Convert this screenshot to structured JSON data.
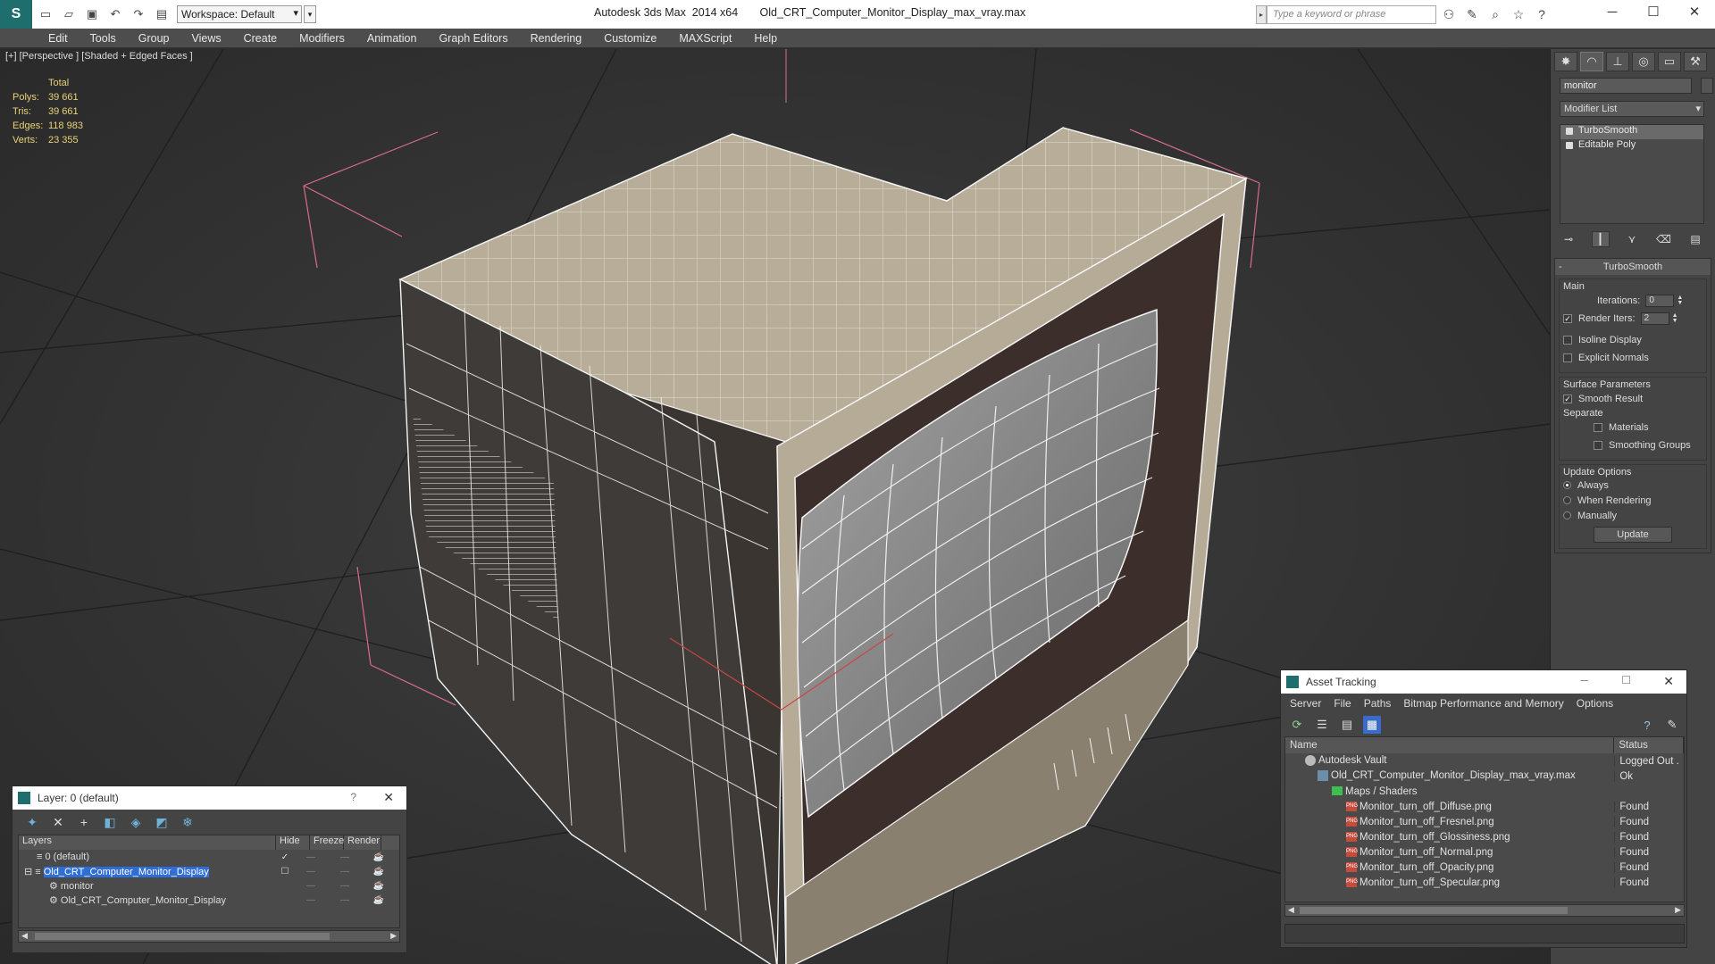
{
  "titlebar": {
    "workspace": "Workspace: Default",
    "title": "Autodesk 3ds Max  2014 x64       Old_CRT_Computer_Monitor_Display_max_vray.max",
    "search_placeholder": "Type a keyword or phrase"
  },
  "menu": [
    "Edit",
    "Tools",
    "Group",
    "Views",
    "Create",
    "Modifiers",
    "Animation",
    "Graph Editors",
    "Rendering",
    "Customize",
    "MAXScript",
    "Help"
  ],
  "viewport": {
    "label": "[+] [Perspective ] [Shaded + Edged Faces ]",
    "stats": {
      "header": "Total",
      "rows": [
        {
          "k": "Polys:",
          "v": "39 661"
        },
        {
          "k": "Tris:",
          "v": "39 661"
        },
        {
          "k": "Edges:",
          "v": "118 983"
        },
        {
          "k": "Verts:",
          "v": "23 355"
        }
      ]
    }
  },
  "command_panel": {
    "object_name": "monitor",
    "modifier_list": "Modifier List",
    "stack": [
      "TurboSmooth",
      "Editable Poly"
    ],
    "rollout_title": "TurboSmooth",
    "main_group": "Main",
    "iterations_label": "Iterations:",
    "iterations_value": "0",
    "render_iters_label": "Render Iters:",
    "render_iters_value": "2",
    "isoline": "Isoline Display",
    "explicit_normals": "Explicit Normals",
    "surface_group": "Surface Parameters",
    "smooth_result": "Smooth Result",
    "separate": "Separate",
    "materials": "Materials",
    "smoothing_groups": "Smoothing Groups",
    "update_group": "Update Options",
    "always": "Always",
    "when_rendering": "When Rendering",
    "manually": "Manually",
    "update_btn": "Update"
  },
  "layers": {
    "title": "Layer: 0 (default)",
    "help": "?",
    "columns": {
      "name": "Layers",
      "hide": "Hide",
      "freeze": "Freeze",
      "render": "Render"
    },
    "rows": [
      {
        "name": "0 (default)"
      },
      {
        "name": "Old_CRT_Computer_Monitor_Display"
      },
      {
        "name": "monitor"
      },
      {
        "name": "Old_CRT_Computer_Monitor_Display"
      }
    ]
  },
  "asset": {
    "title": "Asset Tracking",
    "menu": [
      "Server",
      "File",
      "Paths",
      "Bitmap Performance and Memory",
      "Options"
    ],
    "columns": {
      "name": "Name",
      "status": "Status"
    },
    "rows": [
      {
        "name": "Autodesk Vault",
        "status": "Logged Out ."
      },
      {
        "name": "Old_CRT_Computer_Monitor_Display_max_vray.max",
        "status": "Ok"
      },
      {
        "name": "Maps / Shaders",
        "status": ""
      },
      {
        "name": "Monitor_turn_off_Diffuse.png",
        "status": "Found"
      },
      {
        "name": "Monitor_turn_off_Fresnel.png",
        "status": "Found"
      },
      {
        "name": "Monitor_turn_off_Glossiness.png",
        "status": "Found"
      },
      {
        "name": "Monitor_turn_off_Normal.png",
        "status": "Found"
      },
      {
        "name": "Monitor_turn_off_Opacity.png",
        "status": "Found"
      },
      {
        "name": "Monitor_turn_off_Specular.png",
        "status": "Found"
      }
    ]
  }
}
